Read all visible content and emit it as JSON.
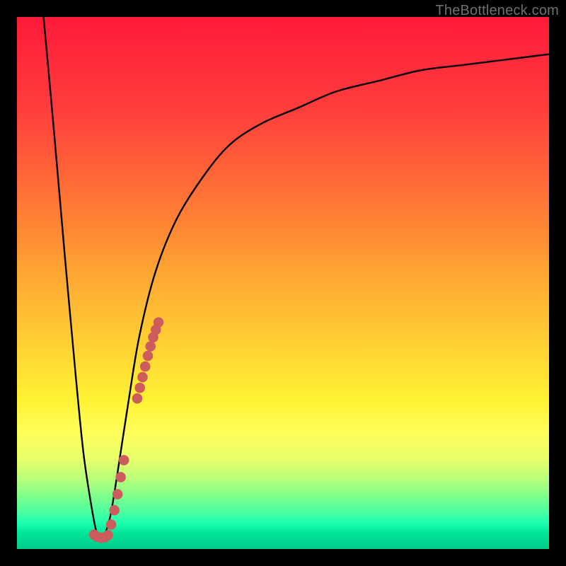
{
  "watermark": "TheBottleneck.com",
  "colors": {
    "background": "#000000",
    "curve": "#000000",
    "marker_fill": "#cd5c5c",
    "marker_stroke": "#cd5c5c"
  },
  "chart_data": {
    "type": "line",
    "title": "",
    "xlabel": "",
    "ylabel": "",
    "xlim": [
      0,
      100
    ],
    "ylim": [
      0,
      100
    ],
    "series": [
      {
        "name": "bottleneck-curve",
        "x": [
          5,
          7,
          9,
          11,
          12.5,
          14,
          15,
          16,
          17.5,
          19,
          21,
          23,
          26,
          30,
          35,
          40,
          46,
          53,
          60,
          68,
          76,
          84,
          92,
          100
        ],
        "y": [
          100,
          78,
          55,
          33,
          18,
          8,
          3,
          2,
          6,
          15,
          28,
          40,
          52,
          62,
          70,
          76,
          80,
          83,
          86,
          88,
          90,
          91,
          92,
          93
        ]
      }
    ],
    "markers": [
      {
        "name": "hook-low-1",
        "x": 14.5,
        "y": 2.7
      },
      {
        "name": "hook-low-2",
        "x": 15.1,
        "y": 2.3
      },
      {
        "name": "hook-low-3",
        "x": 15.8,
        "y": 2.1
      },
      {
        "name": "hook-low-4",
        "x": 16.5,
        "y": 2.2
      },
      {
        "name": "hook-low-5",
        "x": 17.1,
        "y": 2.6
      },
      {
        "name": "rise-1",
        "x": 17.7,
        "y": 4.6
      },
      {
        "name": "rise-2",
        "x": 18.3,
        "y": 7.3
      },
      {
        "name": "rise-3",
        "x": 18.9,
        "y": 10.3
      },
      {
        "name": "rise-4",
        "x": 19.5,
        "y": 13.5
      },
      {
        "name": "rise-5",
        "x": 20.1,
        "y": 16.7
      },
      {
        "name": "seg-1",
        "x": 22.6,
        "y": 28.3
      },
      {
        "name": "seg-2",
        "x": 23.1,
        "y": 30.3
      },
      {
        "name": "seg-3",
        "x": 23.6,
        "y": 32.3
      },
      {
        "name": "seg-4",
        "x": 24.1,
        "y": 34.3
      },
      {
        "name": "seg-5",
        "x": 24.6,
        "y": 36.3
      },
      {
        "name": "seg-6",
        "x": 25.1,
        "y": 38.1
      },
      {
        "name": "seg-7",
        "x": 25.6,
        "y": 39.8
      },
      {
        "name": "seg-8",
        "x": 26.1,
        "y": 41.2
      },
      {
        "name": "seg-9",
        "x": 26.6,
        "y": 42.6
      }
    ]
  }
}
